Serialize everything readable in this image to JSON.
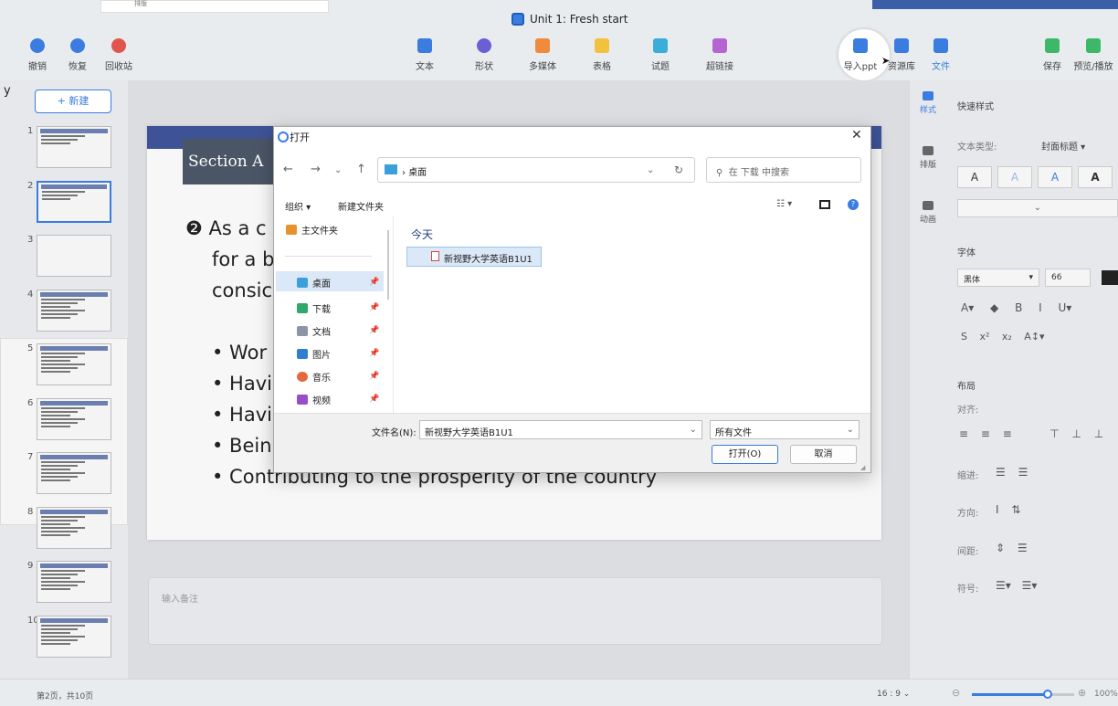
{
  "window": {
    "title": "Unit 1: Fresh start"
  },
  "toolbar": {
    "undo": "撤销",
    "redo": "恢复",
    "recycle": "回收站",
    "text": "文本",
    "shape": "形状",
    "media": "多媒体",
    "table": "表格",
    "quiz": "试题",
    "link": "超链接",
    "import_ppt": "导入ppt",
    "resources": "资源库",
    "file": "文件",
    "save": "保存",
    "preview": "预览/播放",
    "top_fragment": "排版"
  },
  "left": {
    "new_button": "+ 新建",
    "slides": [
      "1",
      "2",
      "3",
      "4",
      "5",
      "6",
      "7",
      "8",
      "9",
      "10"
    ],
    "stray_char": "y"
  },
  "slide": {
    "section": "Section A",
    "line1": "❷ As a c",
    "line2": "for a b",
    "line3": "consic",
    "bullets": [
      "• Wor",
      "• Havi",
      "• Havi",
      "• Bein",
      "• Contributing to the prosperity of the country"
    ]
  },
  "notes": {
    "placeholder": "输入备注"
  },
  "right_strip": {
    "style": "样式",
    "layout": "排版",
    "animation": "动画"
  },
  "right_panel": {
    "quick_style": "快速样式",
    "text_type_label": "文本类型:",
    "text_type_value": "封面标题",
    "font_section": "字体",
    "font_name": "黑体",
    "font_size": "66",
    "layout_section": "布局",
    "align_label": "对齐:",
    "indent_label": "缩进:",
    "direction_label": "方向:",
    "spacing_label": "间距:",
    "symbol_label": "符号:"
  },
  "status": {
    "page": "第2页，共10页",
    "ratio": "16 : 9",
    "zoom": "100%"
  },
  "dialog": {
    "title": "打开",
    "path": "桌面",
    "search_placeholder": "在 下载 中搜索",
    "organize": "组织 ▾",
    "new_folder": "新建文件夹",
    "nav": {
      "home": "主文件夹",
      "desktop": "桌面",
      "downloads": "下载",
      "docs": "文档",
      "pictures": "图片",
      "music": "音乐",
      "videos": "视频"
    },
    "group_today": "今天",
    "file": "新视野大学英语B1U1",
    "filename_label": "文件名(N):",
    "filename_value": "新视野大学英语B1U1",
    "filetype": "所有文件",
    "open": "打开(O)",
    "cancel": "取消"
  }
}
